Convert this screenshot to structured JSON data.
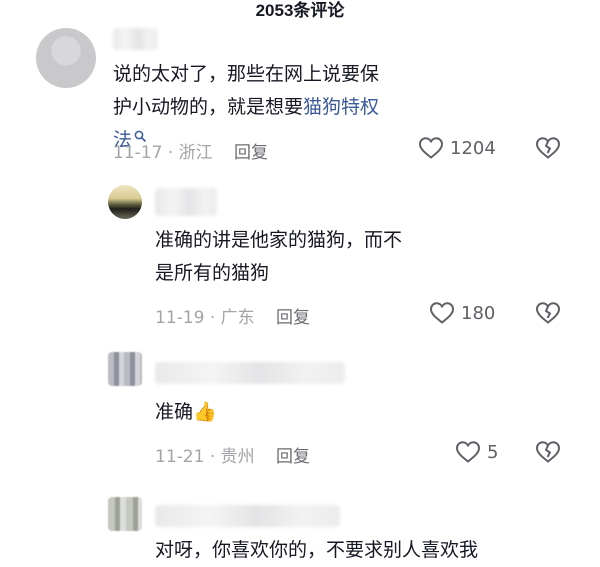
{
  "header": {
    "title": "2053条评论"
  },
  "comments": [
    {
      "text_before": "说的太对了，那些在网上说要保护小动物的，就是想要",
      "link_text": "猫狗特权法",
      "date": "11-17",
      "location": "浙江",
      "reply_label": "回复",
      "likes": "1204"
    },
    {
      "text": "准确的讲是他家的猫狗，而不是所有的猫狗",
      "date": "11-19",
      "location": "广东",
      "reply_label": "回复",
      "likes": "180"
    },
    {
      "text": "准确",
      "emoji": "👍",
      "date": "11-21",
      "location": "贵州",
      "reply_label": "回复",
      "likes": "5"
    },
    {
      "text": "对呀，你喜欢你的，不要求别人喜欢我"
    }
  ],
  "meta_separator": "·",
  "icons": {
    "like": "heart-outline-icon",
    "dislike": "broken-heart-icon",
    "search": "search-icon"
  },
  "colors": {
    "link": "#3c5a9a",
    "meta": "#a3a4a8",
    "text": "#161823"
  }
}
